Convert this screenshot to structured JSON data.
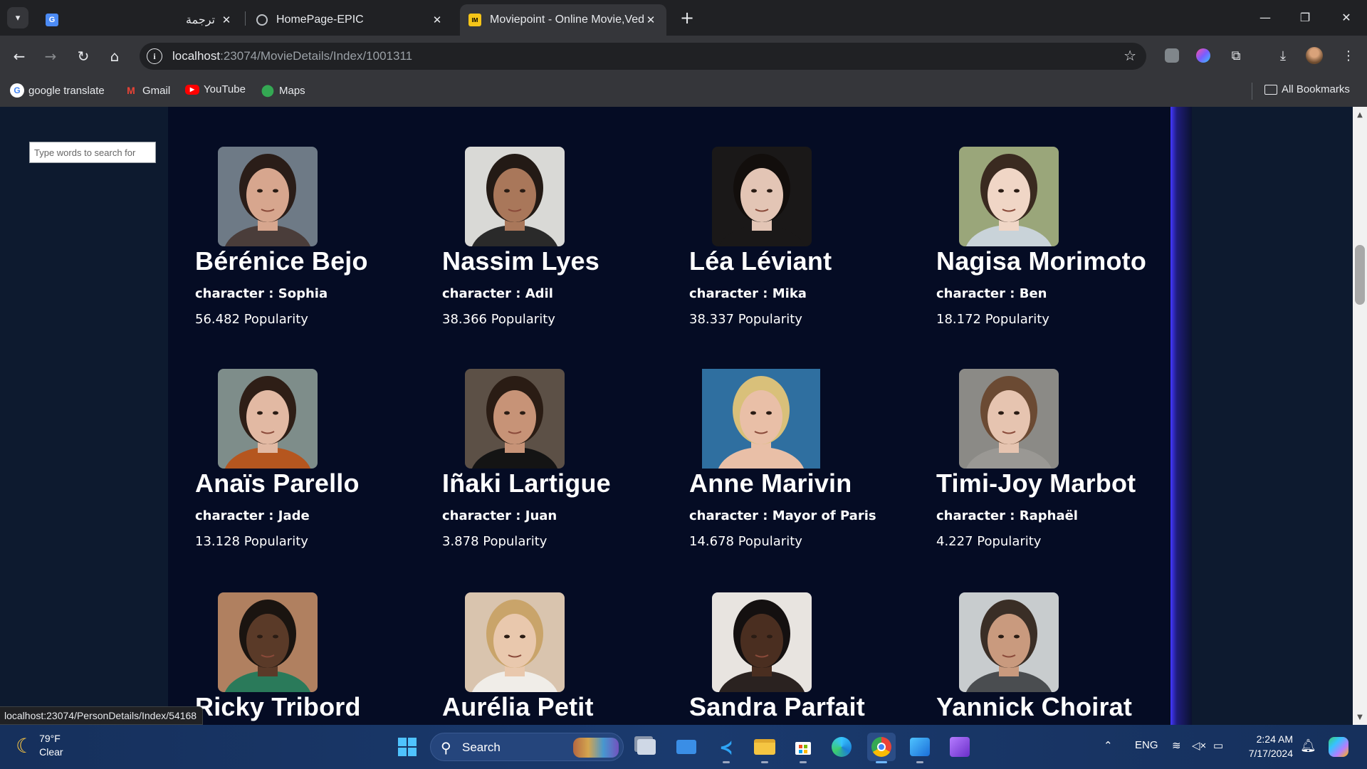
{
  "browser": {
    "tabs": [
      {
        "title": "ترجمة",
        "favicon": "google-translate-icon",
        "active": false
      },
      {
        "title": "HomePage-EPIC",
        "favicon": "page-icon",
        "active": false
      },
      {
        "title": "Moviepoint - Online Movie,Ved",
        "favicon": "imdb-icon",
        "active": true
      }
    ],
    "url_host": "localhost",
    "url_path": ":23074/MovieDetails/Index/1001311",
    "bookmarks": [
      {
        "label": "google translate",
        "icon": "google-icon"
      },
      {
        "label": "Gmail",
        "icon": "gmail-icon"
      },
      {
        "label": "YouTube",
        "icon": "youtube-icon"
      },
      {
        "label": "Maps",
        "icon": "maps-icon"
      }
    ],
    "all_bookmarks": "All Bookmarks"
  },
  "page": {
    "search_placeholder": "Type words to search for",
    "status_url": "localhost:23074/PersonDetails/Index/54168"
  },
  "cast": [
    {
      "name": "Bérénice Bejo",
      "character": "character : Sophia",
      "popularity": "56.482 Popularity",
      "photo_tones": {
        "bg": "#6e7a86",
        "skin": "#d7a68e",
        "hair": "#2a1d18",
        "shirt": "#4a3d3a"
      }
    },
    {
      "name": "Nassim Lyes",
      "character": "character : Adil",
      "popularity": "38.366 Popularity",
      "photo_tones": {
        "bg": "#d9d9d6",
        "skin": "#a9775a",
        "hair": "#231a15",
        "shirt": "#2a2a2a"
      }
    },
    {
      "name": "Léa Léviant",
      "character": "character : Mika",
      "popularity": "38.337 Popularity",
      "photo_tones": {
        "bg": "#1a1818",
        "skin": "#e3c5b5",
        "hair": "#120e0c",
        "shirt": "#1a1818"
      }
    },
    {
      "name": "Nagisa Morimoto",
      "character": "character : Ben",
      "popularity": "18.172 Popularity",
      "photo_tones": {
        "bg": "#9aa67a",
        "skin": "#f0d6c6",
        "hair": "#3a2a20",
        "shirt": "#c9d3d9"
      }
    },
    {
      "name": "Anaïs Parello",
      "character": "character : Jade",
      "popularity": "13.128 Popularity",
      "photo_tones": {
        "bg": "#7e8d8a",
        "skin": "#e2b9a3",
        "hair": "#2e1e16",
        "shirt": "#b5561f"
      }
    },
    {
      "name": "Iñaki Lartigue",
      "character": "character : Juan",
      "popularity": "3.878 Popularity",
      "photo_tones": {
        "bg": "#5c5046",
        "skin": "#c79377",
        "hair": "#2a1c14",
        "shirt": "#141414"
      }
    },
    {
      "name": "Anne Marivin",
      "character": "character : Mayor of Paris",
      "popularity": "14.678 Popularity",
      "photo_tones": {
        "bg": "#2f6fa0",
        "skin": "#e9bfa7",
        "hair": "#d9c07a",
        "shirt": "#e9bfa7"
      }
    },
    {
      "name": "Timi-Joy Marbot",
      "character": "character : Raphaël",
      "popularity": "4.227 Popularity",
      "photo_tones": {
        "bg": "#8b8a86",
        "skin": "#e6c4b0",
        "hair": "#6b4a33",
        "shirt": "#9a9894"
      }
    },
    {
      "name": "Ricky Tribord",
      "character": "",
      "popularity": "",
      "photo_tones": {
        "bg": "#b08060",
        "skin": "#5a3a28",
        "hair": "#1a1410",
        "shirt": "#2a7a5a"
      }
    },
    {
      "name": "Aurélia Petit",
      "character": "",
      "popularity": "",
      "photo_tones": {
        "bg": "#d9c4ae",
        "skin": "#e9c8ad",
        "hair": "#c9a46a",
        "shirt": "#f0ede8"
      }
    },
    {
      "name": "Sandra Parfait",
      "character": "",
      "popularity": "",
      "photo_tones": {
        "bg": "#e8e4e0",
        "skin": "#4a2e20",
        "hair": "#141010",
        "shirt": "#2a2220"
      }
    },
    {
      "name": "Yannick Choirat",
      "character": "",
      "popularity": "",
      "photo_tones": {
        "bg": "#c8ccce",
        "skin": "#c99a7e",
        "hair": "#3a2e26",
        "shirt": "#4a4d50"
      }
    }
  ],
  "taskbar": {
    "temperature": "79°F",
    "condition": "Clear",
    "search_label": "Search",
    "language": "ENG",
    "time": "2:24 AM",
    "date": "7/17/2024",
    "apps": [
      "windows-start-icon",
      "task-view-icon",
      "mail-icon",
      "vscode-icon",
      "file-explorer-icon",
      "microsoft-store-icon",
      "edge-icon",
      "chrome-icon",
      "photos-icon",
      "visual-studio-icon"
    ]
  },
  "colors": {
    "page_bg": "#050c24",
    "accent_glow": "#4338ff"
  }
}
